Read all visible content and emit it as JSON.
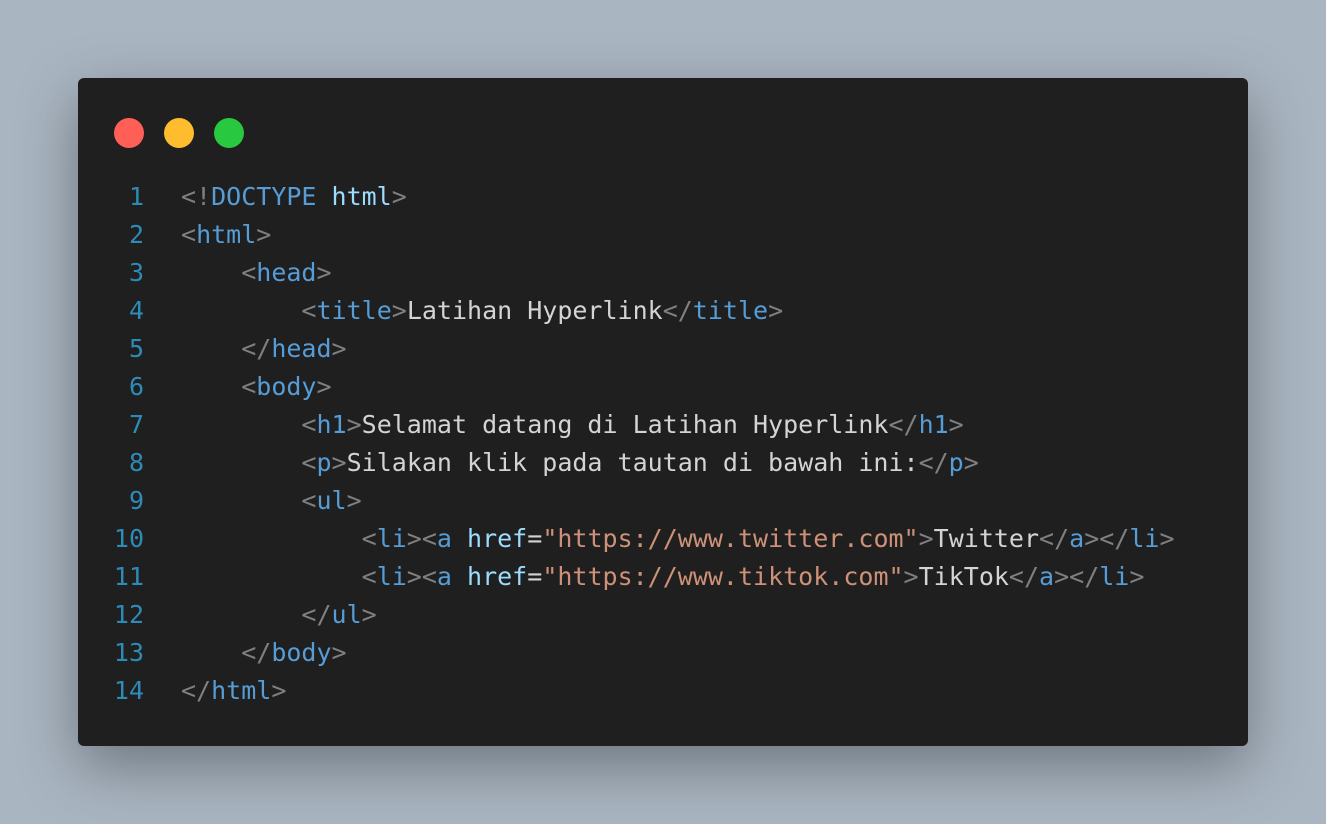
{
  "window": {
    "controls": [
      {
        "name": "close",
        "color": "#ff5f57"
      },
      {
        "name": "minimize",
        "color": "#febc2e"
      },
      {
        "name": "maximize",
        "color": "#28c840"
      }
    ]
  },
  "colors": {
    "background": "#a9b5c1",
    "editor": "#1f1f1f",
    "line_number": "#2d8bb8",
    "punctuation": "#808080",
    "tag": "#569cd6",
    "attribute": "#9cdcfe",
    "string": "#ce9178",
    "text": "#d4d4d4"
  },
  "code": {
    "lines": [
      {
        "num": "1",
        "indent": "",
        "tokens": [
          {
            "t": "punc",
            "v": "<!"
          },
          {
            "t": "tag",
            "v": "DOCTYPE"
          },
          {
            "t": "text",
            "v": " "
          },
          {
            "t": "attr",
            "v": "html"
          },
          {
            "t": "punc",
            "v": ">"
          }
        ]
      },
      {
        "num": "2",
        "indent": "",
        "tokens": [
          {
            "t": "punc",
            "v": "<"
          },
          {
            "t": "tag",
            "v": "html"
          },
          {
            "t": "punc",
            "v": ">"
          }
        ]
      },
      {
        "num": "3",
        "indent": "    ",
        "tokens": [
          {
            "t": "punc",
            "v": "<"
          },
          {
            "t": "tag",
            "v": "head"
          },
          {
            "t": "punc",
            "v": ">"
          }
        ]
      },
      {
        "num": "4",
        "indent": "        ",
        "tokens": [
          {
            "t": "punc",
            "v": "<"
          },
          {
            "t": "tag",
            "v": "title"
          },
          {
            "t": "punc",
            "v": ">"
          },
          {
            "t": "text",
            "v": "Latihan Hyperlink"
          },
          {
            "t": "punc",
            "v": "</"
          },
          {
            "t": "tag",
            "v": "title"
          },
          {
            "t": "punc",
            "v": ">"
          }
        ]
      },
      {
        "num": "5",
        "indent": "    ",
        "tokens": [
          {
            "t": "punc",
            "v": "</"
          },
          {
            "t": "tag",
            "v": "head"
          },
          {
            "t": "punc",
            "v": ">"
          }
        ]
      },
      {
        "num": "6",
        "indent": "    ",
        "tokens": [
          {
            "t": "punc",
            "v": "<"
          },
          {
            "t": "tag",
            "v": "body"
          },
          {
            "t": "punc",
            "v": ">"
          }
        ]
      },
      {
        "num": "7",
        "indent": "        ",
        "tokens": [
          {
            "t": "punc",
            "v": "<"
          },
          {
            "t": "tag",
            "v": "h1"
          },
          {
            "t": "punc",
            "v": ">"
          },
          {
            "t": "text",
            "v": "Selamat datang di Latihan Hyperlink"
          },
          {
            "t": "punc",
            "v": "</"
          },
          {
            "t": "tag",
            "v": "h1"
          },
          {
            "t": "punc",
            "v": ">"
          }
        ]
      },
      {
        "num": "8",
        "indent": "        ",
        "tokens": [
          {
            "t": "punc",
            "v": "<"
          },
          {
            "t": "tag",
            "v": "p"
          },
          {
            "t": "punc",
            "v": ">"
          },
          {
            "t": "text",
            "v": "Silakan klik pada tautan di bawah ini:"
          },
          {
            "t": "punc",
            "v": "</"
          },
          {
            "t": "tag",
            "v": "p"
          },
          {
            "t": "punc",
            "v": ">"
          }
        ]
      },
      {
        "num": "9",
        "indent": "        ",
        "tokens": [
          {
            "t": "punc",
            "v": "<"
          },
          {
            "t": "tag",
            "v": "ul"
          },
          {
            "t": "punc",
            "v": ">"
          }
        ]
      },
      {
        "num": "10",
        "indent": "            ",
        "tokens": [
          {
            "t": "punc",
            "v": "<"
          },
          {
            "t": "tag",
            "v": "li"
          },
          {
            "t": "punc",
            "v": "><"
          },
          {
            "t": "tag",
            "v": "a"
          },
          {
            "t": "text",
            "v": " "
          },
          {
            "t": "attr",
            "v": "href"
          },
          {
            "t": "text",
            "v": "="
          },
          {
            "t": "str",
            "v": "\"https://www.twitter.com\""
          },
          {
            "t": "punc",
            "v": ">"
          },
          {
            "t": "text",
            "v": "Twitter"
          },
          {
            "t": "punc",
            "v": "</"
          },
          {
            "t": "tag",
            "v": "a"
          },
          {
            "t": "punc",
            "v": "></"
          },
          {
            "t": "tag",
            "v": "li"
          },
          {
            "t": "punc",
            "v": ">"
          }
        ]
      },
      {
        "num": "11",
        "indent": "            ",
        "tokens": [
          {
            "t": "punc",
            "v": "<"
          },
          {
            "t": "tag",
            "v": "li"
          },
          {
            "t": "punc",
            "v": "><"
          },
          {
            "t": "tag",
            "v": "a"
          },
          {
            "t": "text",
            "v": " "
          },
          {
            "t": "attr",
            "v": "href"
          },
          {
            "t": "text",
            "v": "="
          },
          {
            "t": "str",
            "v": "\"https://www.tiktok.com\""
          },
          {
            "t": "punc",
            "v": ">"
          },
          {
            "t": "text",
            "v": "TikTok"
          },
          {
            "t": "punc",
            "v": "</"
          },
          {
            "t": "tag",
            "v": "a"
          },
          {
            "t": "punc",
            "v": "></"
          },
          {
            "t": "tag",
            "v": "li"
          },
          {
            "t": "punc",
            "v": ">"
          }
        ]
      },
      {
        "num": "12",
        "indent": "        ",
        "tokens": [
          {
            "t": "punc",
            "v": "</"
          },
          {
            "t": "tag",
            "v": "ul"
          },
          {
            "t": "punc",
            "v": ">"
          }
        ]
      },
      {
        "num": "13",
        "indent": "    ",
        "tokens": [
          {
            "t": "punc",
            "v": "</"
          },
          {
            "t": "tag",
            "v": "body"
          },
          {
            "t": "punc",
            "v": ">"
          }
        ]
      },
      {
        "num": "14",
        "indent": "",
        "tokens": [
          {
            "t": "punc",
            "v": "</"
          },
          {
            "t": "tag",
            "v": "html"
          },
          {
            "t": "punc",
            "v": ">"
          }
        ]
      }
    ]
  }
}
